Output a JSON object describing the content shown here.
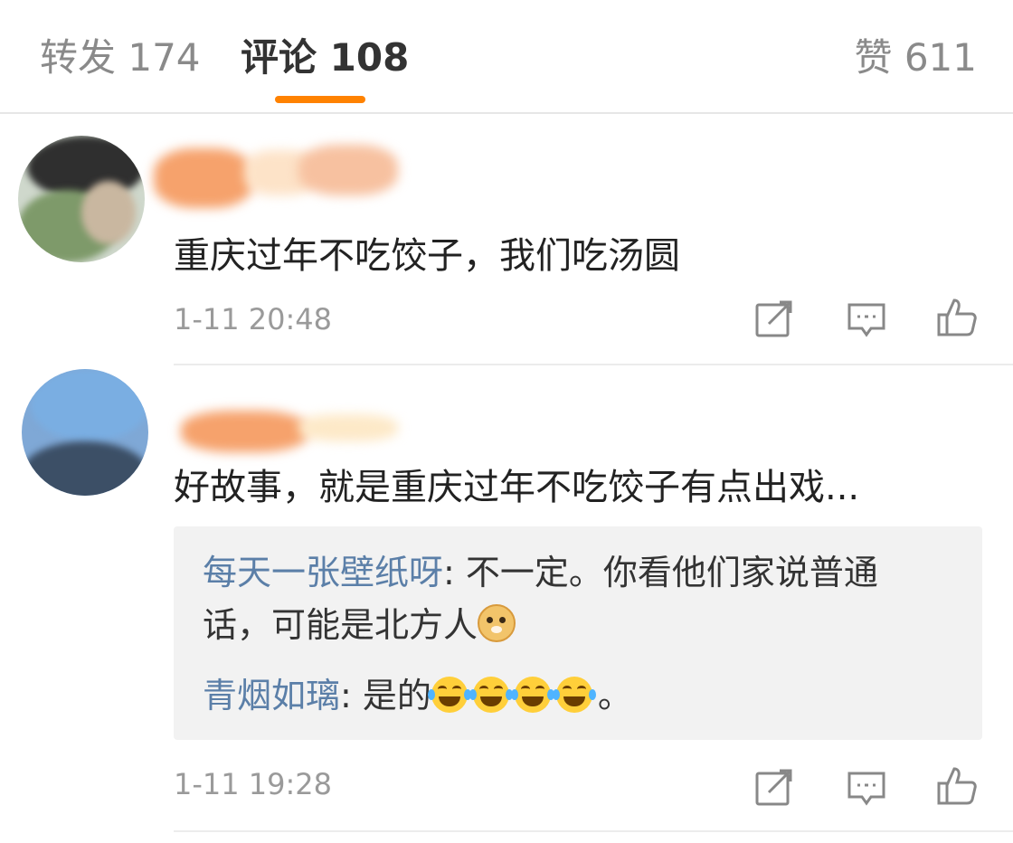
{
  "tabs": {
    "repost": "转发 174",
    "comment": "评论 108",
    "like": "赞 611"
  },
  "comments": [
    {
      "text": "重庆过年不吃饺子，我们吃汤圆",
      "time": "1-11 20:48"
    },
    {
      "text": "好故事，就是重庆过年不吃饺子有点出戏...",
      "time": "1-11 19:28",
      "replies": [
        {
          "user": "每天一张壁纸呀",
          "text_line1": ": 不一定。你看他们家说普通",
          "text_line2": "话，可能是北方人"
        },
        {
          "user": "青烟如璃",
          "text": ": 是的",
          "suffix": "。"
        }
      ]
    }
  ],
  "icons": {
    "share": "share-edit-icon",
    "comment": "comment-bubble-icon",
    "like": "thumbs-up-icon"
  },
  "colors": {
    "accent": "#ff8200",
    "link": "#5b7fa8",
    "muted": "#9a9a9a"
  }
}
